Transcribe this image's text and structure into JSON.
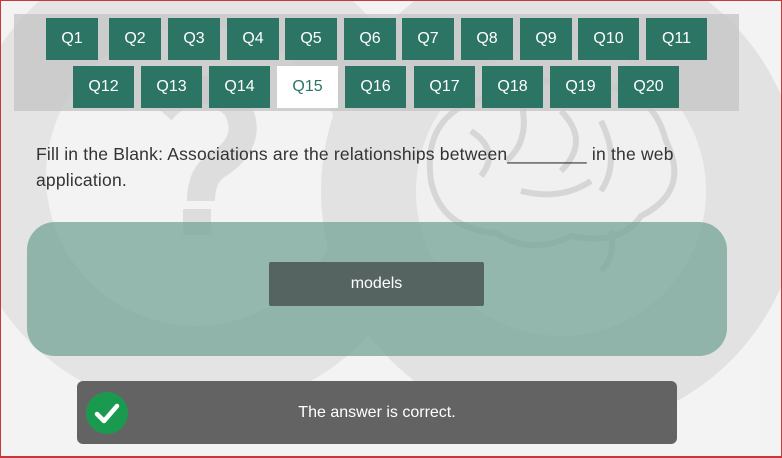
{
  "quiz_nav": {
    "row1": [
      "Q1",
      "Q2",
      "Q3",
      "Q4",
      "Q5",
      "Q6",
      "Q7",
      "Q8",
      "Q9",
      "Q10",
      "Q11"
    ],
    "row2": [
      "Q12",
      "Q13",
      "Q14",
      "Q15",
      "Q16",
      "Q17",
      "Q18",
      "Q19",
      "Q20"
    ],
    "active": "Q15"
  },
  "question": {
    "text": "Fill in the Blank: Associations are the relationships between________ in the web application."
  },
  "answer": {
    "selected_label": "models"
  },
  "result": {
    "message": "The answer is correct.",
    "icon": "check-icon",
    "icon_color": "#1a9a4f"
  },
  "colors": {
    "accent": "#2c7464",
    "panel": "#78a69a",
    "result_bg": "#636363"
  }
}
